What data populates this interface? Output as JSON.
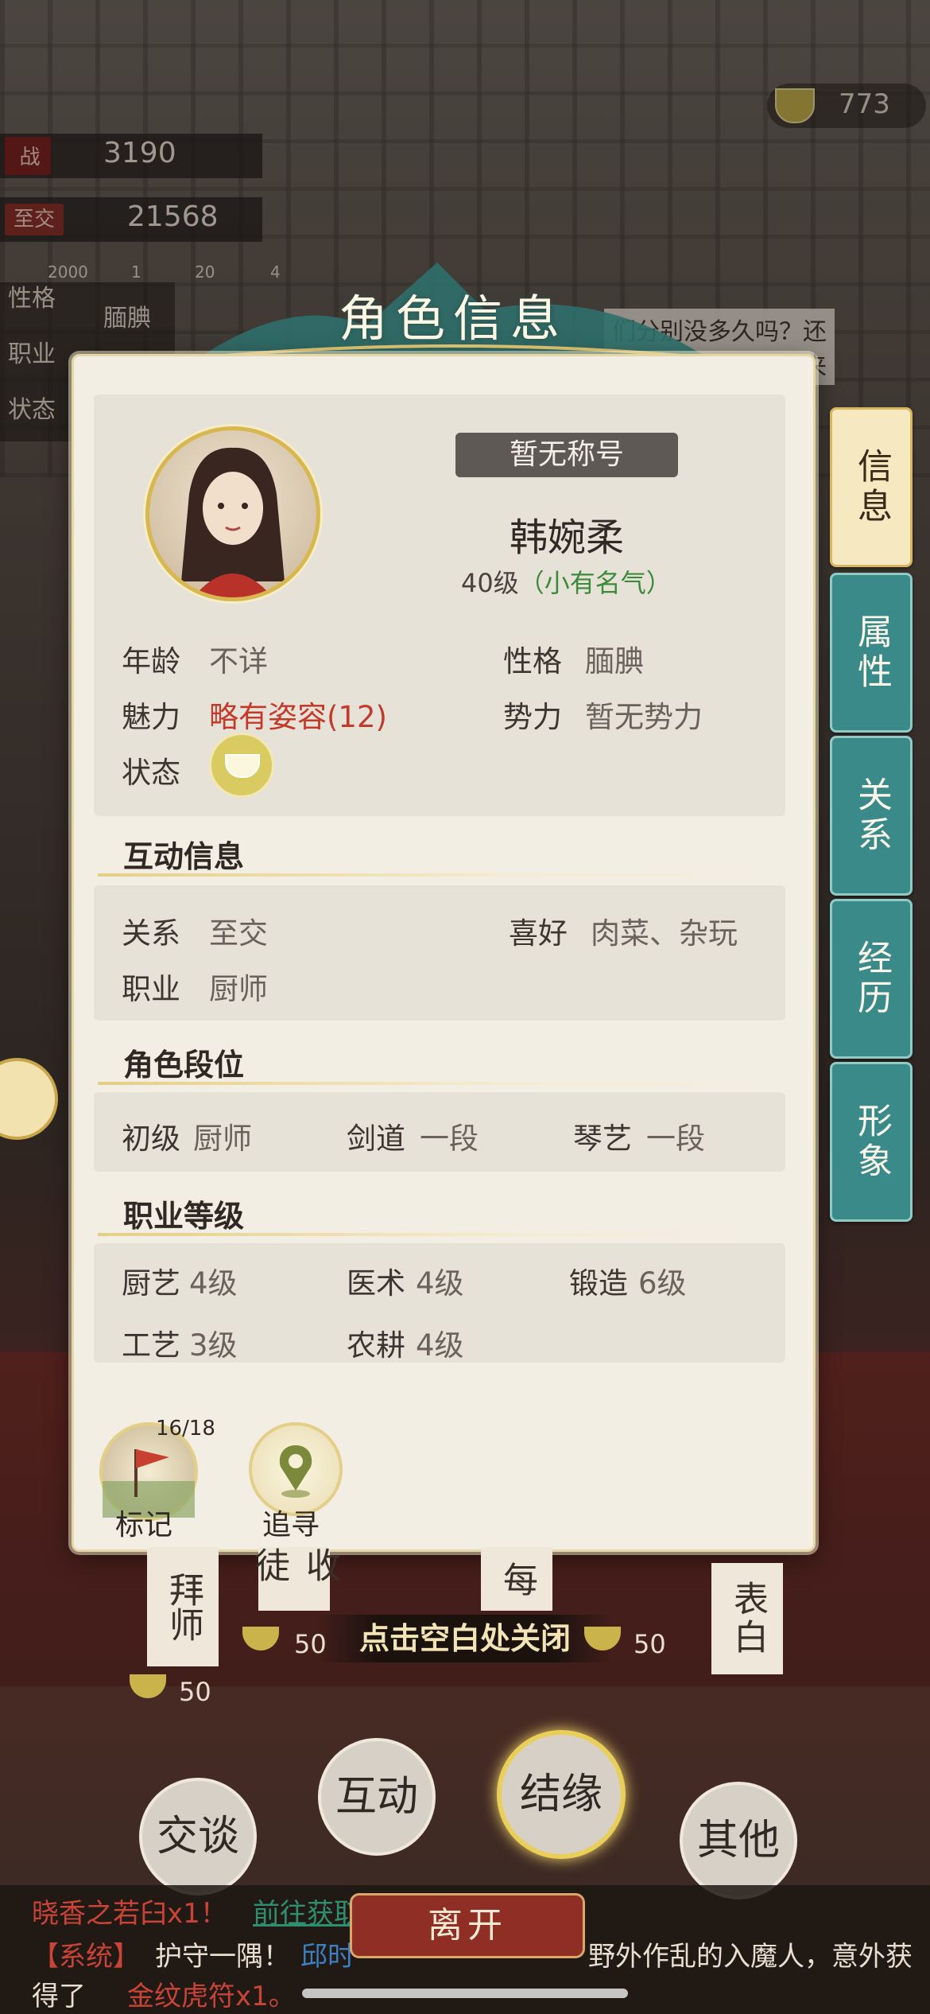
{
  "hud": {
    "currency_value": "773",
    "power_label": "战力",
    "power_value": "3190",
    "relation_tag": "至交",
    "relation_value": "21568",
    "counts": [
      "2000",
      "1",
      "20",
      "4"
    ],
    "side_labels": {
      "personality": "性格",
      "job": "职业",
      "status": "状态"
    },
    "personality_value": "腼腆",
    "dialog_fragment_1": "们分别没多久吗？还",
    "dialog_fragment_2": "来"
  },
  "dialog": {
    "title": "角色信息",
    "honorific": "暂无称号",
    "name": "韩婉柔",
    "level": "40级",
    "fame": "（小有名气）",
    "basic": {
      "age_label": "年龄",
      "age_value": "不详",
      "personality_label": "性格",
      "personality_value": "腼腆",
      "charm_label": "魅力",
      "charm_value": "略有姿容(12)",
      "faction_label": "势力",
      "faction_value": "暂无势力",
      "status_label": "状态"
    },
    "interaction": {
      "heading": "互动信息",
      "relation_label": "关系",
      "relation_value": "至交",
      "hobby_label": "喜好",
      "hobby_value": "肉菜、杂玩",
      "job_label": "职业",
      "job_value": "厨师"
    },
    "rank": {
      "heading": "角色段位",
      "items": [
        {
          "label": "初级",
          "value": "厨师"
        },
        {
          "label": "剑道",
          "value": "一段"
        },
        {
          "label": "琴艺",
          "value": "一段"
        }
      ]
    },
    "profession": {
      "heading": "职业等级",
      "items": [
        {
          "label": "厨艺",
          "value": "4级"
        },
        {
          "label": "医术",
          "value": "4级"
        },
        {
          "label": "锻造",
          "value": "6级"
        },
        {
          "label": "工艺",
          "value": "3级"
        },
        {
          "label": "农耕",
          "value": "4级"
        }
      ]
    },
    "mark_count": "16/18",
    "mark_label": "标记",
    "track_label": "追寻",
    "tabs": [
      "信息",
      "属性",
      "关系",
      "经历",
      "形象"
    ]
  },
  "close_hint": "点击空白处关闭",
  "behind": {
    "btn_master": "拜师",
    "btn_apprentice": "收徒",
    "btn_3": "每",
    "btn_confess": "表白",
    "cost_1": "50",
    "cost_2": "50",
    "cost_3": "50"
  },
  "actions": {
    "talk": "交谈",
    "interact": "互动",
    "bond": "结缘",
    "other": "其他",
    "leave": "离开"
  },
  "log": {
    "line1_a": "晓香之若臼x1！",
    "line1_b": "前往获取",
    "line2_a": "【系统】",
    "line2_b": "护守一隅！",
    "line2_c": "邱时",
    "line2_d": "野外作乱的入魔人，意外获",
    "line3_a": "得了",
    "line3_b": "金纹虎符x1。"
  },
  "colors": {
    "teal_tab": "#3a8a8a",
    "active_tab": "#f6e9c2",
    "charm_red": "#c23a2a",
    "fame_green": "#3c8a3a",
    "leave_red": "#8e2e25"
  }
}
